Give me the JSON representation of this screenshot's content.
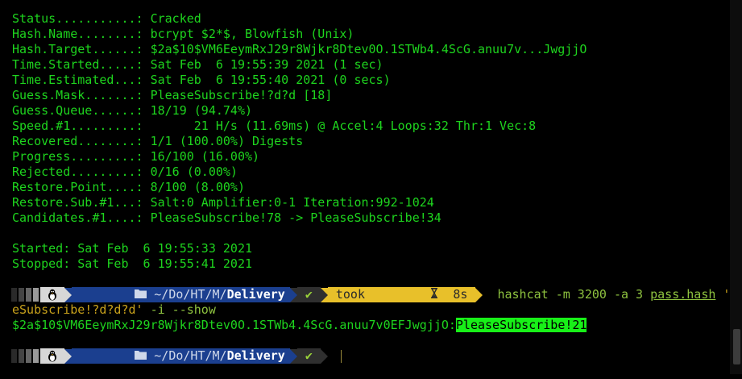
{
  "output": {
    "status": "Status...........: Cracked",
    "hash_name": "Hash.Name........: bcrypt $2*$, Blowfish (Unix)",
    "hash_target": "Hash.Target......: $2a$10$VM6EeymRxJ29r8Wjkr8Dtev0O.1STWb4.4ScG.anuu7v...JwgjjO",
    "time_started": "Time.Started.....: Sat Feb  6 19:55:39 2021 (1 sec)",
    "time_estimated": "Time.Estimated...: Sat Feb  6 19:55:40 2021 (0 secs)",
    "guess_mask": "Guess.Mask.......: PleaseSubscribe!?d?d [18]",
    "guess_queue": "Guess.Queue......: 18/19 (94.74%)",
    "speed": "Speed.#1.........:       21 H/s (11.69ms) @ Accel:4 Loops:32 Thr:1 Vec:8",
    "recovered": "Recovered........: 1/1 (100.00%) Digests",
    "progress": "Progress.........: 16/100 (16.00%)",
    "rejected": "Rejected.........: 0/16 (0.00%)",
    "restore_point": "Restore.Point....: 8/100 (8.00%)",
    "restore_sub": "Restore.Sub.#1...: Salt:0 Amplifier:0-1 Iteration:992-1024",
    "candidates": "Candidates.#1....: PleaseSubscribe!78 -> PleaseSubscribe!34",
    "started": "Started: Sat Feb  6 19:55:33 2021",
    "stopped": "Stopped: Sat Feb  6 19:55:41 2021"
  },
  "prompt1": {
    "os_icon": "linux-penguin-icon",
    "dir_prefix": "~/Do/HT/M/",
    "dir_current": "Delivery",
    "status_mark": "✔",
    "took_label": "took",
    "took_time": "8s"
  },
  "command": {
    "part1": "hashcat -m 3200 -a 3 ",
    "file": "pass.hash",
    "part2_line1": " 'Pleas",
    "part2_line2": "eSubscribe!?d?d?d'",
    "part3": " -i --show"
  },
  "result": {
    "hash": "$2a$10$VM6EeymRxJ29r8Wjkr8Dtev0O.1STWb4.4ScG.anuu7v0EFJwgjjO:",
    "password": "PleaseSubscribe!21"
  },
  "prompt2": {
    "os_icon": "linux-penguin-icon",
    "dir_prefix": "~/Do/HT/M/",
    "dir_current": "Delivery",
    "status_mark": "✔"
  },
  "colors": {
    "output_text": "#1ed41e",
    "dir_segment": "#1b3f8f",
    "took_segment": "#e8c02a",
    "password_highlight": "#18f018"
  }
}
